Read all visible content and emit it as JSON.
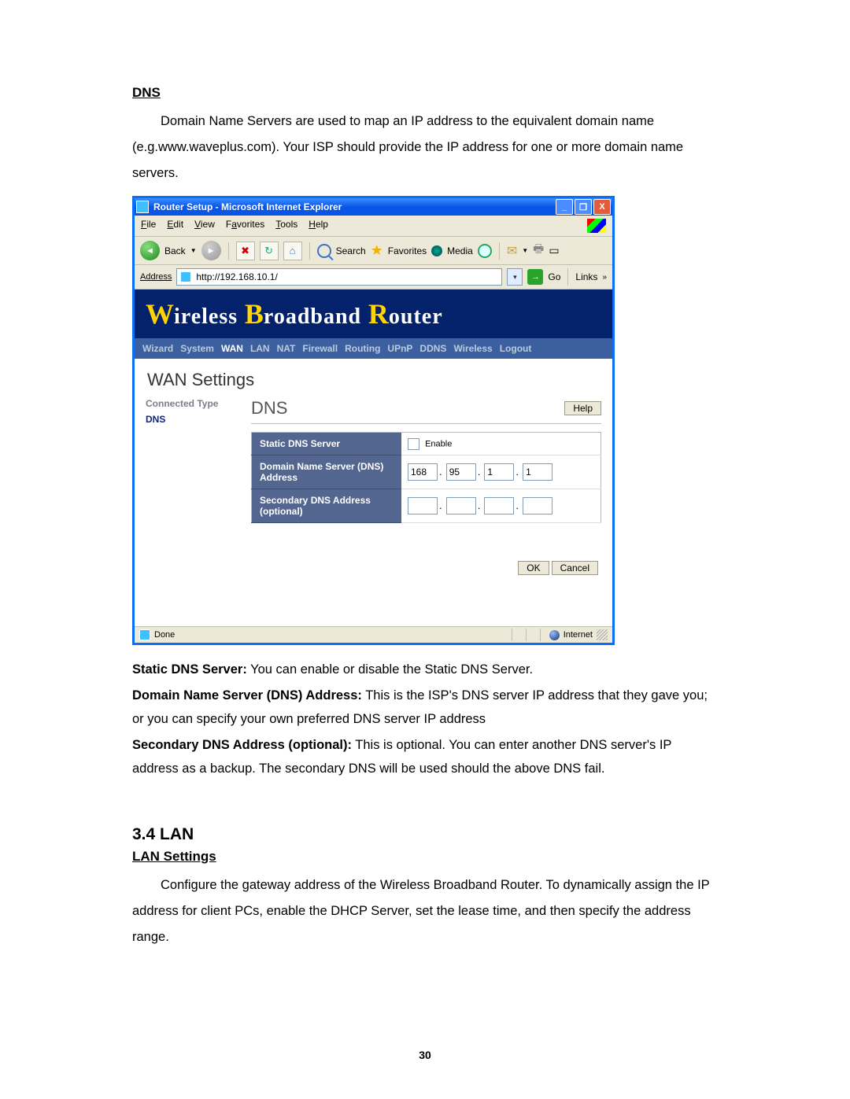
{
  "doc": {
    "dns_hdr": "DNS",
    "dns_para": "Domain Name Servers are used to map an IP address to the equivalent domain name (e.g.www.waveplus.com). Your ISP should provide the IP address for one or more domain name servers.",
    "under_shot": {
      "l1b": "Static DNS Server:",
      "l1": " You can enable or disable the Static DNS Server.",
      "l2b": "Domain Name Server (DNS) Address:",
      "l2": " This is the ISP's DNS server IP address that they gave you; or you can specify your own preferred DNS server IP address",
      "l3b": "Secondary DNS Address (optional):",
      "l3": " This is optional. You can enter another DNS server's IP address as a backup. The secondary DNS will be used should the above DNS fail."
    },
    "sec_num": "3.4   LAN",
    "lan_hdr": "LAN Settings",
    "lan_para": "Configure the gateway address of the Wireless Broadband Router. To dynamically assign the IP address for client PCs, enable the DHCP Server, set the lease time, and then specify the address range.",
    "page_number": "30"
  },
  "ie": {
    "title": "Router Setup - Microsoft Internet Explorer",
    "win_btns": {
      "min": "_",
      "max": "❐",
      "close": "X"
    },
    "menus": {
      "file": "File",
      "edit": "Edit",
      "view": "View",
      "fav": "Favorites",
      "tools": "Tools",
      "help": "Help"
    },
    "tb": {
      "back": "Back",
      "stop": "✖",
      "refresh": "↻",
      "home": "⌂",
      "search": "Search",
      "fav": "Favorites",
      "media": "Media"
    },
    "addr": {
      "lbl": "Address",
      "url": "http://192.168.10.1/",
      "go": "Go",
      "links": "Links",
      "more": "»"
    },
    "status": {
      "done": "Done",
      "zone": "Internet"
    }
  },
  "router": {
    "banner_words": [
      "W",
      "ireless",
      "B",
      "roadband",
      "R",
      "outer"
    ],
    "nav": [
      "Wizard",
      "System",
      "WAN",
      "LAN",
      "NAT",
      "Firewall",
      "Routing",
      "UPnP",
      "DDNS",
      "Wireless",
      "Logout"
    ],
    "active_nav": "WAN",
    "page_title": "WAN Settings",
    "side": {
      "l1": "Connected Type",
      "l2": "DNS"
    },
    "dns_title": "DNS",
    "help_btn": "Help",
    "rows": {
      "r1": "Static DNS Server",
      "r2": "Domain Name Server (DNS) Address",
      "r3": "Secondary DNS Address (optional)"
    },
    "enable_lbl": "Enable",
    "ip": {
      "a": "168",
      "b": "95",
      "c": "1",
      "d": "1"
    },
    "ok": "OK",
    "cancel": "Cancel"
  }
}
